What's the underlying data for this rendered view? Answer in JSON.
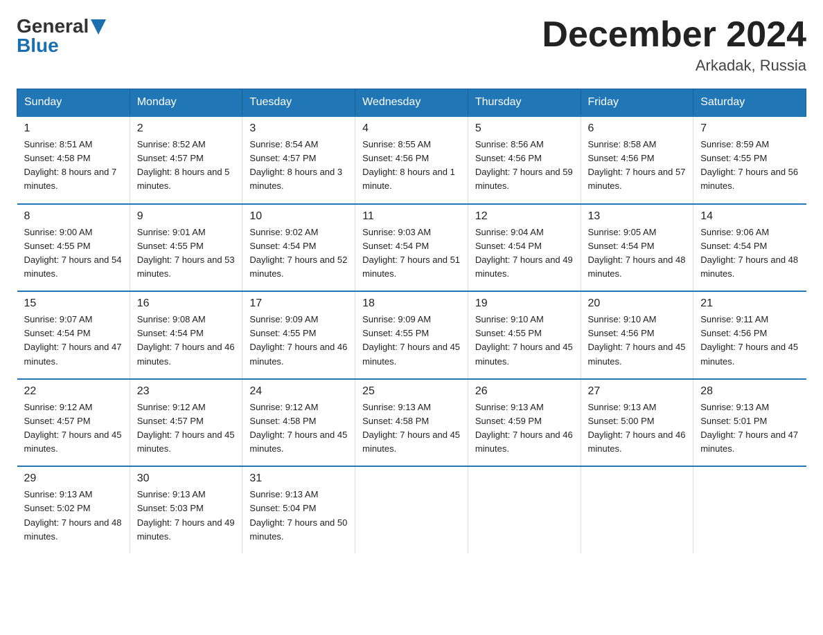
{
  "logo": {
    "general": "General",
    "blue": "Blue"
  },
  "title": "December 2024",
  "location": "Arkadak, Russia",
  "days_of_week": [
    "Sunday",
    "Monday",
    "Tuesday",
    "Wednesday",
    "Thursday",
    "Friday",
    "Saturday"
  ],
  "weeks": [
    [
      {
        "day": "1",
        "sunrise": "8:51 AM",
        "sunset": "4:58 PM",
        "daylight": "8 hours and 7 minutes."
      },
      {
        "day": "2",
        "sunrise": "8:52 AM",
        "sunset": "4:57 PM",
        "daylight": "8 hours and 5 minutes."
      },
      {
        "day": "3",
        "sunrise": "8:54 AM",
        "sunset": "4:57 PM",
        "daylight": "8 hours and 3 minutes."
      },
      {
        "day": "4",
        "sunrise": "8:55 AM",
        "sunset": "4:56 PM",
        "daylight": "8 hours and 1 minute."
      },
      {
        "day": "5",
        "sunrise": "8:56 AM",
        "sunset": "4:56 PM",
        "daylight": "7 hours and 59 minutes."
      },
      {
        "day": "6",
        "sunrise": "8:58 AM",
        "sunset": "4:56 PM",
        "daylight": "7 hours and 57 minutes."
      },
      {
        "day": "7",
        "sunrise": "8:59 AM",
        "sunset": "4:55 PM",
        "daylight": "7 hours and 56 minutes."
      }
    ],
    [
      {
        "day": "8",
        "sunrise": "9:00 AM",
        "sunset": "4:55 PM",
        "daylight": "7 hours and 54 minutes."
      },
      {
        "day": "9",
        "sunrise": "9:01 AM",
        "sunset": "4:55 PM",
        "daylight": "7 hours and 53 minutes."
      },
      {
        "day": "10",
        "sunrise": "9:02 AM",
        "sunset": "4:54 PM",
        "daylight": "7 hours and 52 minutes."
      },
      {
        "day": "11",
        "sunrise": "9:03 AM",
        "sunset": "4:54 PM",
        "daylight": "7 hours and 51 minutes."
      },
      {
        "day": "12",
        "sunrise": "9:04 AM",
        "sunset": "4:54 PM",
        "daylight": "7 hours and 49 minutes."
      },
      {
        "day": "13",
        "sunrise": "9:05 AM",
        "sunset": "4:54 PM",
        "daylight": "7 hours and 48 minutes."
      },
      {
        "day": "14",
        "sunrise": "9:06 AM",
        "sunset": "4:54 PM",
        "daylight": "7 hours and 48 minutes."
      }
    ],
    [
      {
        "day": "15",
        "sunrise": "9:07 AM",
        "sunset": "4:54 PM",
        "daylight": "7 hours and 47 minutes."
      },
      {
        "day": "16",
        "sunrise": "9:08 AM",
        "sunset": "4:54 PM",
        "daylight": "7 hours and 46 minutes."
      },
      {
        "day": "17",
        "sunrise": "9:09 AM",
        "sunset": "4:55 PM",
        "daylight": "7 hours and 46 minutes."
      },
      {
        "day": "18",
        "sunrise": "9:09 AM",
        "sunset": "4:55 PM",
        "daylight": "7 hours and 45 minutes."
      },
      {
        "day": "19",
        "sunrise": "9:10 AM",
        "sunset": "4:55 PM",
        "daylight": "7 hours and 45 minutes."
      },
      {
        "day": "20",
        "sunrise": "9:10 AM",
        "sunset": "4:56 PM",
        "daylight": "7 hours and 45 minutes."
      },
      {
        "day": "21",
        "sunrise": "9:11 AM",
        "sunset": "4:56 PM",
        "daylight": "7 hours and 45 minutes."
      }
    ],
    [
      {
        "day": "22",
        "sunrise": "9:12 AM",
        "sunset": "4:57 PM",
        "daylight": "7 hours and 45 minutes."
      },
      {
        "day": "23",
        "sunrise": "9:12 AM",
        "sunset": "4:57 PM",
        "daylight": "7 hours and 45 minutes."
      },
      {
        "day": "24",
        "sunrise": "9:12 AM",
        "sunset": "4:58 PM",
        "daylight": "7 hours and 45 minutes."
      },
      {
        "day": "25",
        "sunrise": "9:13 AM",
        "sunset": "4:58 PM",
        "daylight": "7 hours and 45 minutes."
      },
      {
        "day": "26",
        "sunrise": "9:13 AM",
        "sunset": "4:59 PM",
        "daylight": "7 hours and 46 minutes."
      },
      {
        "day": "27",
        "sunrise": "9:13 AM",
        "sunset": "5:00 PM",
        "daylight": "7 hours and 46 minutes."
      },
      {
        "day": "28",
        "sunrise": "9:13 AM",
        "sunset": "5:01 PM",
        "daylight": "7 hours and 47 minutes."
      }
    ],
    [
      {
        "day": "29",
        "sunrise": "9:13 AM",
        "sunset": "5:02 PM",
        "daylight": "7 hours and 48 minutes."
      },
      {
        "day": "30",
        "sunrise": "9:13 AM",
        "sunset": "5:03 PM",
        "daylight": "7 hours and 49 minutes."
      },
      {
        "day": "31",
        "sunrise": "9:13 AM",
        "sunset": "5:04 PM",
        "daylight": "7 hours and 50 minutes."
      },
      null,
      null,
      null,
      null
    ]
  ]
}
